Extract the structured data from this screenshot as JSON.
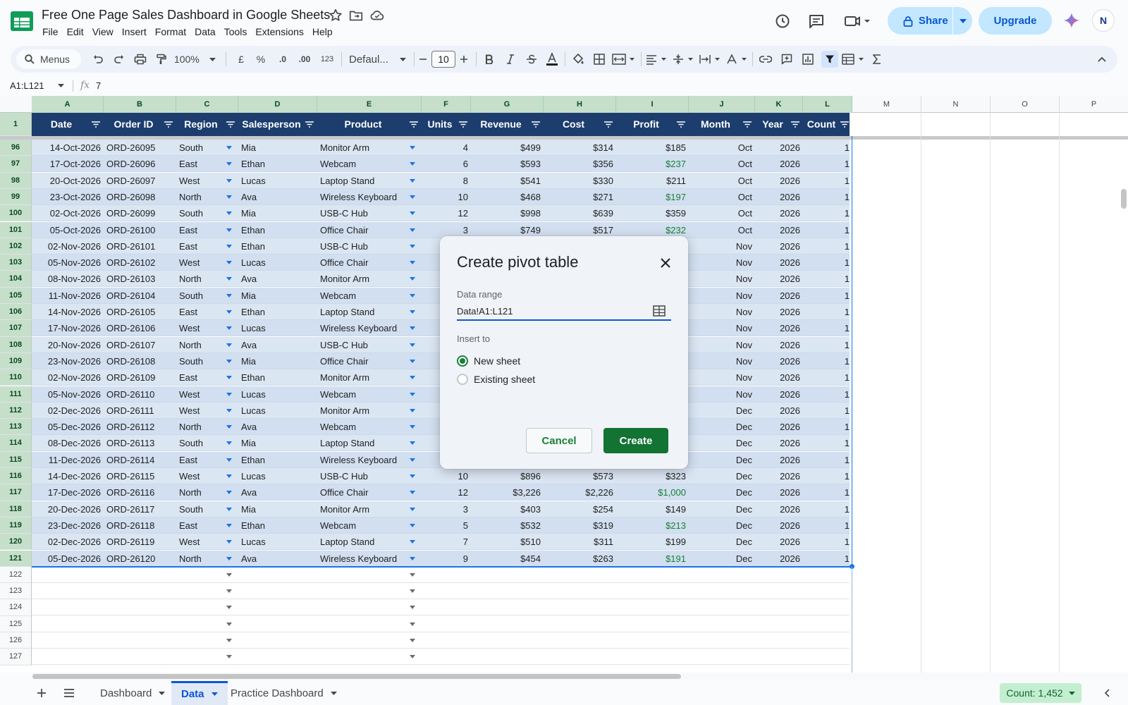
{
  "app": {
    "title": "Free One Page Sales Dashboard in Google Sheets",
    "menus": [
      "File",
      "Edit",
      "View",
      "Insert",
      "Format",
      "Data",
      "Tools",
      "Extensions",
      "Help"
    ],
    "share_label": "Share",
    "upgrade_label": "Upgrade",
    "avatar_initials": "N"
  },
  "toolbar": {
    "search_label": "Menus",
    "zoom": "100%",
    "currency": "£",
    "percent": "%",
    "dec_decrease": ".0",
    "dec_increase": ".00",
    "number_format": "123",
    "font_name": "Defaul...",
    "font_size": "10"
  },
  "formula_bar": {
    "name_box": "A1:L121",
    "formula": "7"
  },
  "columns": [
    "A",
    "B",
    "C",
    "D",
    "E",
    "F",
    "G",
    "H",
    "I",
    "J",
    "K",
    "L",
    "M",
    "N",
    "O",
    "P"
  ],
  "headers": [
    "Date",
    "Order ID",
    "Region",
    "Salesperson",
    "Product",
    "Units",
    "Revenue",
    "Cost",
    "Profit",
    "Month",
    "Year",
    "Count"
  ],
  "header_row_num": "1",
  "rows": [
    {
      "n": "96",
      "date": "14-Oct-2026",
      "id": "ORD-26095",
      "region": "South",
      "sp": "Mia",
      "product": "Monitor Arm",
      "units": "4",
      "rev": "$499",
      "cost": "$314",
      "profit": "$185",
      "pg": false,
      "month": "Oct",
      "year": "2026",
      "count": "1"
    },
    {
      "n": "97",
      "date": "17-Oct-2026",
      "id": "ORD-26096",
      "region": "East",
      "sp": "Ethan",
      "product": "Webcam",
      "units": "6",
      "rev": "$593",
      "cost": "$356",
      "profit": "$237",
      "pg": true,
      "month": "Oct",
      "year": "2026",
      "count": "1"
    },
    {
      "n": "98",
      "date": "20-Oct-2026",
      "id": "ORD-26097",
      "region": "West",
      "sp": "Lucas",
      "product": "Laptop Stand",
      "units": "8",
      "rev": "$541",
      "cost": "$330",
      "profit": "$211",
      "pg": false,
      "month": "Oct",
      "year": "2026",
      "count": "1"
    },
    {
      "n": "99",
      "date": "23-Oct-2026",
      "id": "ORD-26098",
      "region": "North",
      "sp": "Ava",
      "product": "Wireless Keyboard",
      "units": "10",
      "rev": "$468",
      "cost": "$271",
      "profit": "$197",
      "pg": true,
      "month": "Oct",
      "year": "2026",
      "count": "1"
    },
    {
      "n": "100",
      "date": "02-Oct-2026",
      "id": "ORD-26099",
      "region": "South",
      "sp": "Mia",
      "product": "USB-C Hub",
      "units": "12",
      "rev": "$998",
      "cost": "$639",
      "profit": "$359",
      "pg": false,
      "month": "Oct",
      "year": "2026",
      "count": "1"
    },
    {
      "n": "101",
      "date": "05-Oct-2026",
      "id": "ORD-26100",
      "region": "East",
      "sp": "Ethan",
      "product": "Office Chair",
      "units": "3",
      "rev": "$749",
      "cost": "$517",
      "profit": "$232",
      "pg": true,
      "month": "Oct",
      "year": "2026",
      "count": "1"
    },
    {
      "n": "102",
      "date": "02-Nov-2026",
      "id": "ORD-26101",
      "region": "East",
      "sp": "Ethan",
      "product": "USB-C Hub",
      "units": "",
      "rev": "",
      "cost": "",
      "profit": "",
      "pg": false,
      "month": "Nov",
      "year": "2026",
      "count": "1"
    },
    {
      "n": "103",
      "date": "05-Nov-2026",
      "id": "ORD-26102",
      "region": "West",
      "sp": "Lucas",
      "product": "Office Chair",
      "units": "",
      "rev": "",
      "cost": "",
      "profit": "",
      "pg": false,
      "month": "Nov",
      "year": "2026",
      "count": "1"
    },
    {
      "n": "104",
      "date": "08-Nov-2026",
      "id": "ORD-26103",
      "region": "North",
      "sp": "Ava",
      "product": "Monitor Arm",
      "units": "",
      "rev": "",
      "cost": "",
      "profit": "",
      "pg": false,
      "month": "Nov",
      "year": "2026",
      "count": "1"
    },
    {
      "n": "105",
      "date": "11-Nov-2026",
      "id": "ORD-26104",
      "region": "South",
      "sp": "Mia",
      "product": "Webcam",
      "units": "",
      "rev": "",
      "cost": "",
      "profit": "",
      "pg": false,
      "month": "Nov",
      "year": "2026",
      "count": "1"
    },
    {
      "n": "106",
      "date": "14-Nov-2026",
      "id": "ORD-26105",
      "region": "East",
      "sp": "Ethan",
      "product": "Laptop Stand",
      "units": "",
      "rev": "",
      "cost": "",
      "profit": "",
      "pg": false,
      "month": "Nov",
      "year": "2026",
      "count": "1"
    },
    {
      "n": "107",
      "date": "17-Nov-2026",
      "id": "ORD-26106",
      "region": "West",
      "sp": "Lucas",
      "product": "Wireless Keyboard",
      "units": "",
      "rev": "",
      "cost": "",
      "profit": "",
      "pg": false,
      "month": "Nov",
      "year": "2026",
      "count": "1"
    },
    {
      "n": "108",
      "date": "20-Nov-2026",
      "id": "ORD-26107",
      "region": "North",
      "sp": "Ava",
      "product": "USB-C Hub",
      "units": "",
      "rev": "",
      "cost": "",
      "profit": "",
      "pg": false,
      "month": "Nov",
      "year": "2026",
      "count": "1"
    },
    {
      "n": "109",
      "date": "23-Nov-2026",
      "id": "ORD-26108",
      "region": "South",
      "sp": "Mia",
      "product": "Office Chair",
      "units": "",
      "rev": "",
      "cost": "",
      "profit": "",
      "pg": false,
      "month": "Nov",
      "year": "2026",
      "count": "1"
    },
    {
      "n": "110",
      "date": "02-Nov-2026",
      "id": "ORD-26109",
      "region": "East",
      "sp": "Ethan",
      "product": "Monitor Arm",
      "units": "",
      "rev": "",
      "cost": "",
      "profit": "",
      "pg": false,
      "month": "Nov",
      "year": "2026",
      "count": "1"
    },
    {
      "n": "111",
      "date": "05-Nov-2026",
      "id": "ORD-26110",
      "region": "West",
      "sp": "Lucas",
      "product": "Webcam",
      "units": "",
      "rev": "",
      "cost": "",
      "profit": "",
      "pg": false,
      "month": "Nov",
      "year": "2026",
      "count": "1"
    },
    {
      "n": "112",
      "date": "02-Dec-2026",
      "id": "ORD-26111",
      "region": "West",
      "sp": "Lucas",
      "product": "Monitor Arm",
      "units": "",
      "rev": "",
      "cost": "",
      "profit": "",
      "pg": false,
      "month": "Dec",
      "year": "2026",
      "count": "1"
    },
    {
      "n": "113",
      "date": "05-Dec-2026",
      "id": "ORD-26112",
      "region": "North",
      "sp": "Ava",
      "product": "Webcam",
      "units": "",
      "rev": "",
      "cost": "",
      "profit": "",
      "pg": false,
      "month": "Dec",
      "year": "2026",
      "count": "1"
    },
    {
      "n": "114",
      "date": "08-Dec-2026",
      "id": "ORD-26113",
      "region": "South",
      "sp": "Mia",
      "product": "Laptop Stand",
      "units": "",
      "rev": "",
      "cost": "",
      "profit": "",
      "pg": false,
      "month": "Dec",
      "year": "2026",
      "count": "1"
    },
    {
      "n": "115",
      "date": "11-Dec-2026",
      "id": "ORD-26114",
      "region": "East",
      "sp": "Ethan",
      "product": "Wireless Keyboard",
      "units": "",
      "rev": "",
      "cost": "",
      "profit": "",
      "pg": false,
      "month": "Dec",
      "year": "2026",
      "count": "1"
    },
    {
      "n": "116",
      "date": "14-Dec-2026",
      "id": "ORD-26115",
      "region": "West",
      "sp": "Lucas",
      "product": "USB-C Hub",
      "units": "10",
      "rev": "$896",
      "cost": "$573",
      "profit": "$323",
      "pg": false,
      "month": "Dec",
      "year": "2026",
      "count": "1"
    },
    {
      "n": "117",
      "date": "17-Dec-2026",
      "id": "ORD-26116",
      "region": "North",
      "sp": "Ava",
      "product": "Office Chair",
      "units": "12",
      "rev": "$3,226",
      "cost": "$2,226",
      "profit": "$1,000",
      "pg": true,
      "month": "Dec",
      "year": "2026",
      "count": "1"
    },
    {
      "n": "118",
      "date": "20-Dec-2026",
      "id": "ORD-26117",
      "region": "South",
      "sp": "Mia",
      "product": "Monitor Arm",
      "units": "3",
      "rev": "$403",
      "cost": "$254",
      "profit": "$149",
      "pg": false,
      "month": "Dec",
      "year": "2026",
      "count": "1"
    },
    {
      "n": "119",
      "date": "23-Dec-2026",
      "id": "ORD-26118",
      "region": "East",
      "sp": "Ethan",
      "product": "Webcam",
      "units": "5",
      "rev": "$532",
      "cost": "$319",
      "profit": "$213",
      "pg": true,
      "month": "Dec",
      "year": "2026",
      "count": "1"
    },
    {
      "n": "120",
      "date": "02-Dec-2026",
      "id": "ORD-26119",
      "region": "West",
      "sp": "Lucas",
      "product": "Laptop Stand",
      "units": "7",
      "rev": "$510",
      "cost": "$311",
      "profit": "$199",
      "pg": false,
      "month": "Dec",
      "year": "2026",
      "count": "1"
    },
    {
      "n": "121",
      "date": "05-Dec-2026",
      "id": "ORD-26120",
      "region": "North",
      "sp": "Ava",
      "product": "Wireless Keyboard",
      "units": "9",
      "rev": "$454",
      "cost": "$263",
      "profit": "$191",
      "pg": true,
      "month": "Dec",
      "year": "2026",
      "count": "1"
    }
  ],
  "empty_rows": [
    "122",
    "123",
    "124",
    "125",
    "126",
    "127"
  ],
  "sheets": [
    {
      "label": "Dashboard",
      "active": false
    },
    {
      "label": "Data",
      "active": true
    },
    {
      "label": "Practice Dashboard",
      "active": false
    }
  ],
  "status": {
    "count": "Count: 1,452"
  },
  "colors": {
    "header_bg": "#1c3d6e",
    "accent_green": "#137333",
    "link_blue": "#0b57d0"
  },
  "dialog": {
    "title": "Create pivot table",
    "range_label": "Data range",
    "range_value": "Data!A1:L121",
    "insert_label": "Insert to",
    "options": [
      {
        "label": "New sheet",
        "selected": true
      },
      {
        "label": "Existing sheet",
        "selected": false
      }
    ],
    "cancel_label": "Cancel",
    "create_label": "Create"
  }
}
